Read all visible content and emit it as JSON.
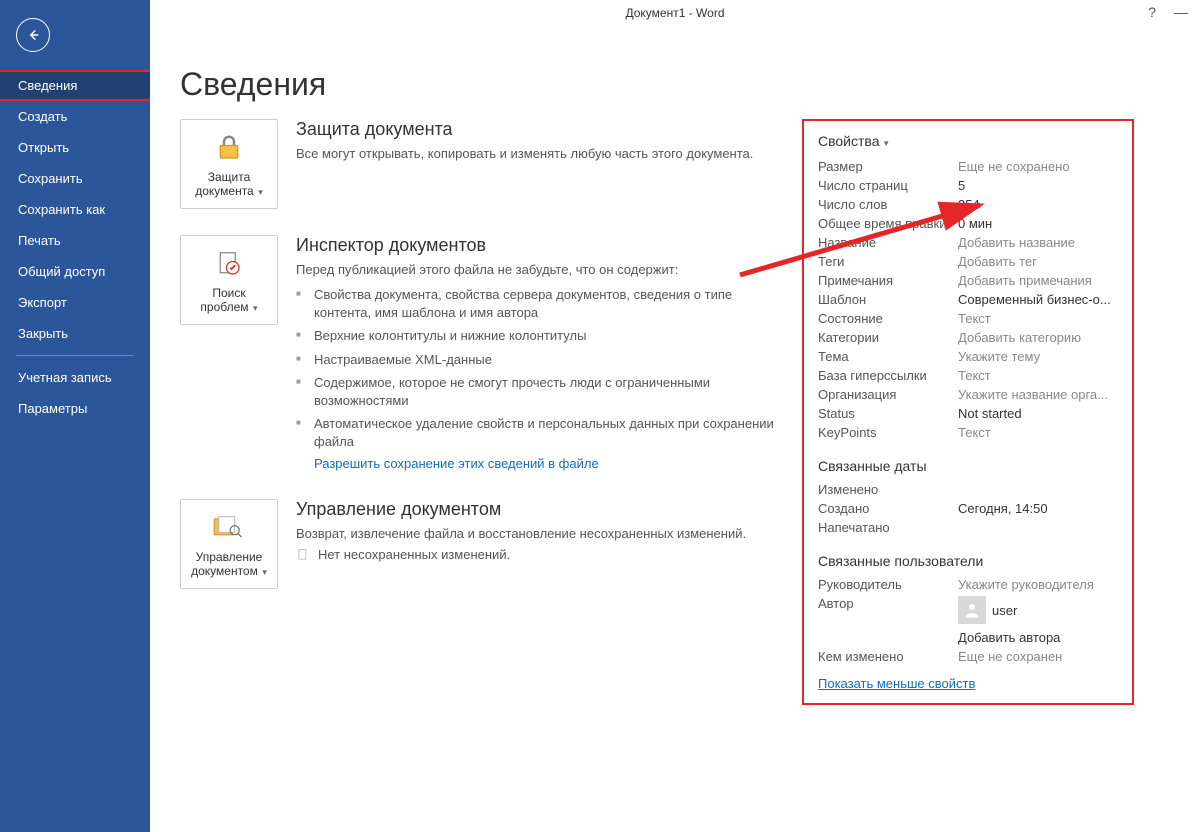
{
  "titlebar": {
    "title": "Документ1 - Word"
  },
  "sidebar": {
    "items": [
      {
        "label": "Сведения",
        "active": true
      },
      {
        "label": "Создать"
      },
      {
        "label": "Открыть"
      },
      {
        "label": "Сохранить"
      },
      {
        "label": "Сохранить как"
      },
      {
        "label": "Печать"
      },
      {
        "label": "Общий доступ"
      },
      {
        "label": "Экспорт"
      },
      {
        "label": "Закрыть"
      }
    ],
    "bottom": [
      {
        "label": "Учетная запись"
      },
      {
        "label": "Параметры"
      }
    ]
  },
  "page": {
    "heading": "Сведения"
  },
  "sections": {
    "protect": {
      "button": "Защита документа",
      "title": "Защита документа",
      "desc": "Все могут открывать, копировать и изменять любую часть этого документа."
    },
    "inspector": {
      "button": "Поиск проблем",
      "title": "Инспектор документов",
      "desc": "Перед публикацией этого файла не забудьте, что он содержит:",
      "bullets": [
        "Свойства документа, свойства сервера документов, сведения о типе контента, имя шаблона и имя автора",
        "Верхние колонтитулы и нижние колонтитулы",
        "Настраиваемые XML-данные",
        "Содержимое, которое не смогут прочесть люди с ограниченными возможностями",
        "Автоматическое удаление свойств и персональных данных при сохранении файла"
      ],
      "link": "Разрешить сохранение этих сведений в файле"
    },
    "manage": {
      "button": "Управление документом",
      "title": "Управление документом",
      "desc": "Возврат, извлечение файла и восстановление несохраненных изменений.",
      "none": "Нет несохраненных изменений."
    }
  },
  "properties": {
    "header": "Свойства",
    "rows": [
      {
        "label": "Размер",
        "value": "Еще не сохранено",
        "placeholder": true
      },
      {
        "label": "Число страниц",
        "value": "5"
      },
      {
        "label": "Число слов",
        "value": "354"
      },
      {
        "label": "Общее время правки",
        "value": "0 мин"
      },
      {
        "label": "Название",
        "value": "Добавить название",
        "placeholder": true
      },
      {
        "label": "Теги",
        "value": "Добавить тег",
        "placeholder": true
      },
      {
        "label": "Примечания",
        "value": "Добавить примечания",
        "placeholder": true
      },
      {
        "label": "Шаблон",
        "value": "Современный бизнес-о..."
      },
      {
        "label": "Состояние",
        "value": "Текст",
        "placeholder": true
      },
      {
        "label": "Категории",
        "value": "Добавить категорию",
        "placeholder": true
      },
      {
        "label": "Тема",
        "value": "Укажите тему",
        "placeholder": true
      },
      {
        "label": "База гиперссылки",
        "value": "Текст",
        "placeholder": true
      },
      {
        "label": "Организация",
        "value": "Укажите название орга...",
        "placeholder": true
      },
      {
        "label": "Status",
        "value": "Not started"
      },
      {
        "label": "KeyPoints",
        "value": "Текст",
        "placeholder": true
      }
    ],
    "dates": {
      "header": "Связанные даты",
      "rows": [
        {
          "label": "Изменено",
          "value": ""
        },
        {
          "label": "Создано",
          "value": "Сегодня, 14:50"
        },
        {
          "label": "Напечатано",
          "value": ""
        }
      ]
    },
    "people": {
      "header": "Связанные пользователи",
      "manager_label": "Руководитель",
      "manager_value": "Укажите руководителя",
      "author_label": "Автор",
      "author_name": "user",
      "add_author": "Добавить автора",
      "lastmod_label": "Кем изменено",
      "lastmod_value": "Еще не сохранен"
    },
    "show_less": "Показать меньше свойств"
  }
}
